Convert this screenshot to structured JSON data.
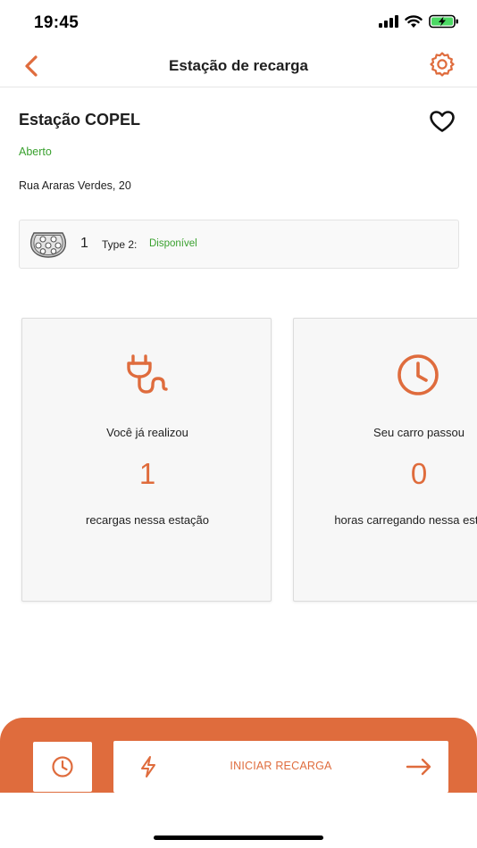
{
  "status_bar": {
    "time": "19:45"
  },
  "nav": {
    "title": "Estação de recarga"
  },
  "station": {
    "name": "Estação COPEL",
    "status": "Aberto",
    "address": "Rua Araras Verdes, 20"
  },
  "connector": {
    "count": "1",
    "type": "Type 2:",
    "availability": "Disponível"
  },
  "stats": [
    {
      "lead": "Você já realizou",
      "value": "1",
      "trail": "recargas nessa estação",
      "icon": "plug-icon"
    },
    {
      "lead": "Seu carro passou",
      "value": "0",
      "trail": "horas carregando nessa estação",
      "icon": "clock-icon"
    }
  ],
  "actions": {
    "start_label": "INICIAR RECARGA"
  },
  "colors": {
    "accent": "#df6c3d",
    "available": "#3aa12f"
  }
}
